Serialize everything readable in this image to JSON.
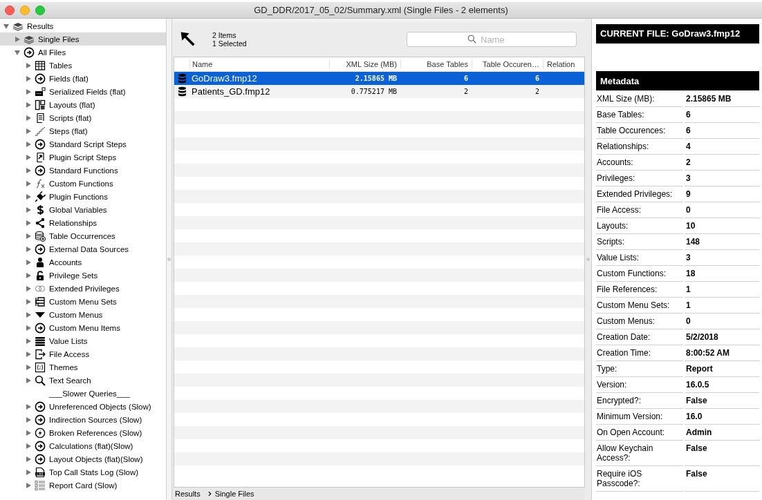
{
  "window": {
    "title": "GD_DDR/2017_05_02/Summary.xml  (Single Files - 2 elements)"
  },
  "sidebar": {
    "tree": [
      {
        "label": "Results",
        "kind": "stack",
        "expanded": true,
        "selected": false,
        "children": [
          {
            "label": "Single Files",
            "kind": "stack",
            "expanded": false,
            "selected": true
          },
          {
            "label": "All Files",
            "kind": "circle-arrow",
            "expanded": true,
            "selected": false,
            "children": [
              {
                "label": "Tables",
                "kind": "grid",
                "expanded": false,
                "selected": false
              },
              {
                "label": "Fields (flat)",
                "kind": "circle-arrow",
                "expanded": false,
                "selected": false
              },
              {
                "label": "Serialized Fields (flat)",
                "kind": "serial",
                "expanded": false,
                "selected": false
              },
              {
                "label": "Layouts (flat)",
                "kind": "layout",
                "expanded": false,
                "selected": false
              },
              {
                "label": "Scripts (flat)",
                "kind": "script",
                "expanded": false,
                "selected": false
              },
              {
                "label": "Steps (flat)",
                "kind": "steps",
                "expanded": false,
                "selected": false
              },
              {
                "label": "Standard Script Steps",
                "kind": "circle-arrow",
                "expanded": false,
                "selected": false
              },
              {
                "label": "Plugin Script Steps",
                "kind": "plugin-script",
                "expanded": false,
                "selected": false
              },
              {
                "label": "Standard Functions",
                "kind": "circle-arrow",
                "expanded": false,
                "selected": false
              },
              {
                "label": "Custom Functions",
                "kind": "fx",
                "expanded": false,
                "selected": false
              },
              {
                "label": "Plugin Functions",
                "kind": "plug",
                "expanded": false,
                "selected": false
              },
              {
                "label": "Global Variables",
                "kind": "dollar",
                "expanded": false,
                "selected": false
              },
              {
                "label": "Relationships",
                "kind": "share",
                "expanded": false,
                "selected": false
              },
              {
                "label": "Table Occurrences",
                "kind": "db-plus",
                "expanded": false,
                "selected": false
              },
              {
                "label": "External Data Sources",
                "kind": "circle-arrow",
                "expanded": false,
                "selected": false
              },
              {
                "label": "Accounts",
                "kind": "person",
                "expanded": false,
                "selected": false
              },
              {
                "label": "Privilege Sets",
                "kind": "lock",
                "expanded": false,
                "selected": false
              },
              {
                "label": "Extended Privileges",
                "kind": "rings",
                "expanded": false,
                "selected": false
              },
              {
                "label": "Custom Menu Sets",
                "kind": "menu-set",
                "expanded": false,
                "selected": false
              },
              {
                "label": "Custom Menus",
                "kind": "down-triangle",
                "expanded": false,
                "selected": false
              },
              {
                "label": "Custom Menu Items",
                "kind": "circle-arrow",
                "expanded": false,
                "selected": false
              },
              {
                "label": "Value Lists",
                "kind": "bars",
                "expanded": false,
                "selected": false
              },
              {
                "label": "File Access",
                "kind": "file-arrow",
                "expanded": false,
                "selected": false
              },
              {
                "label": "Themes",
                "kind": "braces",
                "expanded": false,
                "selected": false
              },
              {
                "label": "Text Search",
                "kind": "search",
                "expanded": false,
                "selected": false
              },
              {
                "label": "___Slower Queries___",
                "kind": "heading",
                "selected": false
              },
              {
                "label": "Unreferenced Objects (Slow)",
                "kind": "circle-arrow",
                "expanded": false,
                "selected": false
              },
              {
                "label": "Indirection Sources (Slow)",
                "kind": "circle-arrow",
                "expanded": false,
                "selected": false
              },
              {
                "label": "Broken References (Slow)",
                "kind": "bolt-circle",
                "expanded": false,
                "selected": false
              },
              {
                "label": "Calculations (flat)(Slow)",
                "kind": "circle-arrow",
                "expanded": false,
                "selected": false
              },
              {
                "label": "Layout Objects (flat)(Slow)",
                "kind": "circle-arrow",
                "expanded": false,
                "selected": false
              },
              {
                "label": "Top Call Stats Log (Slow)",
                "kind": "log",
                "expanded": false,
                "selected": false
              },
              {
                "label": "Report Card (Slow)",
                "kind": "report",
                "expanded": false,
                "selected": false
              }
            ]
          }
        ]
      }
    ]
  },
  "toolbar": {
    "item_count": "2 Items",
    "selection_count": "1 Selected",
    "search": {
      "placeholder": "Name"
    }
  },
  "table": {
    "columns": [
      "Name",
      "XML Size (MB)",
      "Base Tables",
      "Table Occuren…",
      "Relation"
    ],
    "rows": [
      {
        "name": "GoDraw3.fmp12",
        "xml_size": "2.15865 MB",
        "base_tables": "6",
        "table_occurrences": "6",
        "selected": true
      },
      {
        "name": "Patients_GD.fmp12",
        "xml_size": "0.775217 MB",
        "base_tables": "2",
        "table_occurrences": "2",
        "selected": false
      }
    ]
  },
  "breadcrumb": [
    "Results",
    "Single Files"
  ],
  "details": {
    "current_file": "CURRENT FILE: GoDraw3.fmp12",
    "section": "Metadata",
    "fields": [
      {
        "label": "XML Size (MB):",
        "value": "2.15865 MB"
      },
      {
        "label": "Base Tables:",
        "value": "6"
      },
      {
        "label": "Table Occurences:",
        "value": "6"
      },
      {
        "label": "Relationships:",
        "value": "4"
      },
      {
        "label": "Accounts:",
        "value": "2"
      },
      {
        "label": "Privileges:",
        "value": "3"
      },
      {
        "label": "Extended Privileges:",
        "value": "9"
      },
      {
        "label": "File Access:",
        "value": "0"
      },
      {
        "label": "Layouts:",
        "value": "10"
      },
      {
        "label": "Scripts:",
        "value": "148"
      },
      {
        "label": "Value Lists:",
        "value": "3"
      },
      {
        "label": "Custom Functions:",
        "value": "18"
      },
      {
        "label": "File References:",
        "value": "1"
      },
      {
        "label": "Custom Menu Sets:",
        "value": "1"
      },
      {
        "label": "Custom Menus:",
        "value": "0"
      },
      {
        "label": "Creation Date:",
        "value": "5/2/2018"
      },
      {
        "label": "Creation Time:",
        "value": "8:00:52 AM"
      },
      {
        "label": "Type:",
        "value": "Report"
      },
      {
        "label": "Version:",
        "value": "16.0.5"
      },
      {
        "label": "Encrypted?:",
        "value": "False"
      },
      {
        "label": "Minimum Version:",
        "value": "16.0"
      },
      {
        "label": "On Open Account:",
        "value": "Admin"
      },
      {
        "label": "Allow Keychain Access?:",
        "value": "False"
      },
      {
        "label": "Require iOS Passcode?:",
        "value": "False"
      }
    ]
  }
}
